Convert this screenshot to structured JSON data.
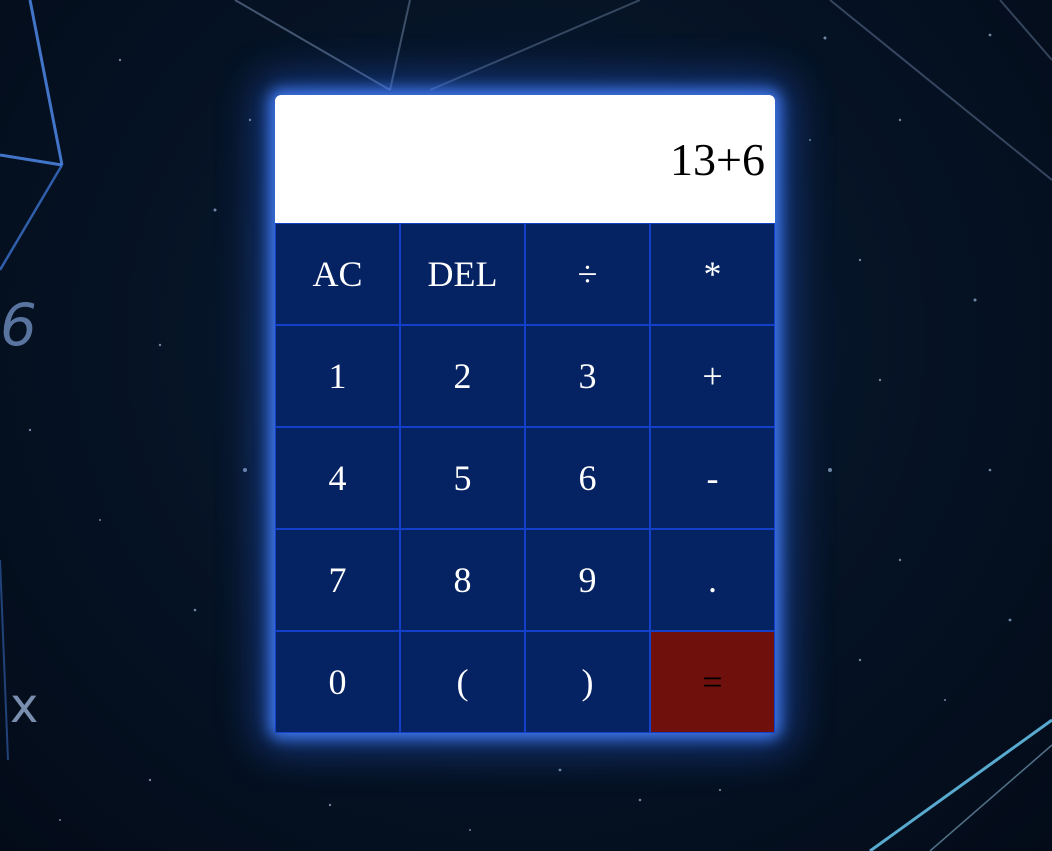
{
  "display": {
    "value": "13+6"
  },
  "keys": [
    {
      "label": "AC",
      "name": "all-clear-button"
    },
    {
      "label": "DEL",
      "name": "delete-button"
    },
    {
      "label": "÷",
      "name": "divide-button"
    },
    {
      "label": "*",
      "name": "multiply-button"
    },
    {
      "label": "1",
      "name": "digit-1-button"
    },
    {
      "label": "2",
      "name": "digit-2-button"
    },
    {
      "label": "3",
      "name": "digit-3-button"
    },
    {
      "label": "+",
      "name": "add-button"
    },
    {
      "label": "4",
      "name": "digit-4-button"
    },
    {
      "label": "5",
      "name": "digit-5-button"
    },
    {
      "label": "6",
      "name": "digit-6-button"
    },
    {
      "label": "-",
      "name": "subtract-button"
    },
    {
      "label": "7",
      "name": "digit-7-button"
    },
    {
      "label": "8",
      "name": "digit-8-button"
    },
    {
      "label": "9",
      "name": "digit-9-button"
    },
    {
      "label": ".",
      "name": "decimal-point-button"
    },
    {
      "label": "0",
      "name": "digit-0-button"
    },
    {
      "label": "(",
      "name": "open-parenthesis-button"
    },
    {
      "label": ")",
      "name": "close-parenthesis-button"
    },
    {
      "label": "=",
      "name": "equals-button"
    }
  ],
  "background_doodles": {
    "six": "6",
    "cross": "x"
  },
  "colors": {
    "key_background": "#052263",
    "key_border": "#1240c8",
    "equals_background": "#6f100c",
    "glow": "#4682ff"
  }
}
